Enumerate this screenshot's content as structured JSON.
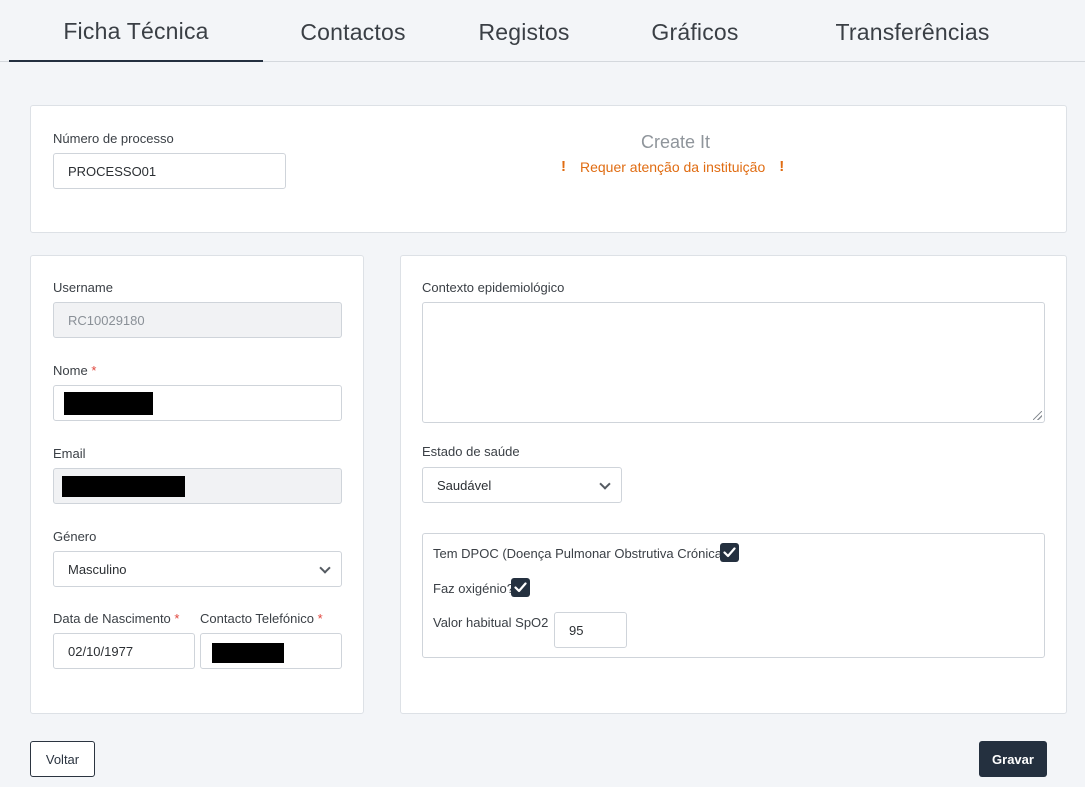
{
  "tabs": [
    {
      "label": "Ficha Técnica",
      "active": true
    },
    {
      "label": "Contactos",
      "active": false
    },
    {
      "label": "Registos",
      "active": false
    },
    {
      "label": "Gráficos",
      "active": false
    },
    {
      "label": "Transferências",
      "active": false
    }
  ],
  "process": {
    "label": "Número de processo",
    "value": "PROCESSO01"
  },
  "create_it": {
    "title": "Create It",
    "alert_text": "Requer atenção da instituição",
    "alert_icon": "!"
  },
  "user": {
    "username_label": "Username",
    "username_value": "RC10029180",
    "nome_label": "Nome",
    "required_mark": "*",
    "email_label": "Email",
    "genero_label": "Género",
    "genero_value": "Masculino",
    "nascimento_label": "Data de Nascimento",
    "nascimento_value": "02/10/1977",
    "contacto_label": "Contacto Telefónico"
  },
  "health": {
    "contexto_label": "Contexto epidemiológico",
    "contexto_value": "",
    "estado_label": "Estado de saúde",
    "estado_value": "Saudável",
    "dpoc_label": "Tem DPOC (Doença Pulmonar Obstrutiva Crónica)",
    "dpoc_checked": true,
    "oxigenio_label": "Faz oxigénio?",
    "oxigenio_checked": true,
    "spo2_label": "Valor habitual SpO2",
    "spo2_value": "95"
  },
  "buttons": {
    "voltar": "Voltar",
    "gravar": "Gravar"
  },
  "colors": {
    "accent_dark": "#24303f",
    "alert_orange": "#e06c12",
    "required_red": "#e0453c"
  }
}
